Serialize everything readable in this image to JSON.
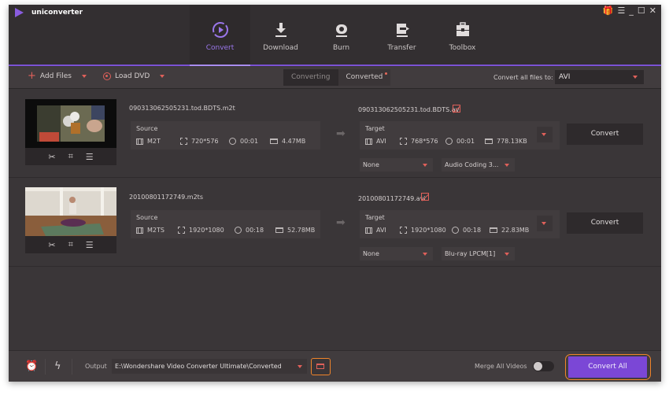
{
  "app": {
    "title": "uniconverter"
  },
  "window_controls": [
    {
      "name": "gift-icon",
      "glyph": "🎁"
    },
    {
      "name": "menu-icon",
      "glyph": "☰"
    },
    {
      "name": "minimize-icon",
      "glyph": "_"
    },
    {
      "name": "maximize-icon",
      "glyph": "☐"
    },
    {
      "name": "close-icon",
      "glyph": "✕"
    }
  ],
  "nav": {
    "active": "Convert",
    "items": [
      {
        "label": "Convert",
        "icon": "convert-icon"
      },
      {
        "label": "Download",
        "icon": "download-icon"
      },
      {
        "label": "Burn",
        "icon": "burn-icon"
      },
      {
        "label": "Transfer",
        "icon": "transfer-icon"
      },
      {
        "label": "Toolbox",
        "icon": "toolbox-icon"
      }
    ]
  },
  "toolbar": {
    "add_files": "Add Files",
    "load_dvd": "Load DVD",
    "tabs": [
      {
        "label": "Converting"
      },
      {
        "label": "Converted"
      }
    ],
    "active_tab": "Converted",
    "convert_all_label": "Convert all files to:",
    "convert_all_format": "AVI"
  },
  "files": [
    {
      "source_name": "090313062505231.tod.BDTS.m2t",
      "source": {
        "caption": "Source",
        "format": "M2T",
        "resolution": "720*576",
        "duration": "00:01",
        "size": "4.47MB"
      },
      "target_name": "090313062505231.tod.BDTS.avi",
      "target": {
        "caption": "Target",
        "format": "AVI",
        "resolution": "768*576",
        "duration": "00:01",
        "size": "778.13KB"
      },
      "subtitle": "None",
      "audio": "Audio Coding 3...",
      "convert_label": "Convert"
    },
    {
      "source_name": "20100801172749.m2ts",
      "source": {
        "caption": "Source",
        "format": "M2TS",
        "resolution": "1920*1080",
        "duration": "00:18",
        "size": "52.78MB"
      },
      "target_name": "20100801172749.avi",
      "target": {
        "caption": "Target",
        "format": "AVI",
        "resolution": "1920*1080",
        "duration": "00:18",
        "size": "22.83MB"
      },
      "subtitle": "None",
      "audio": "Blu-ray LPCM[1]",
      "convert_label": "Convert"
    }
  ],
  "thumb_tools": {
    "cut": "✂",
    "crop": "⌗",
    "effects": "☰"
  },
  "footer": {
    "output_label": "Output",
    "output_path": "E:\\Wondershare Video Converter Ultimate\\Converted",
    "merge_label": "Merge All Videos",
    "merge_enabled": false,
    "convert_all_button": "Convert All",
    "schedule_icon": "⏰",
    "speed_icon": "ϟ"
  },
  "colors": {
    "accent_purple": "#7b47d6",
    "accent_red": "#e0605a",
    "highlight_orange": "#f0842a"
  }
}
